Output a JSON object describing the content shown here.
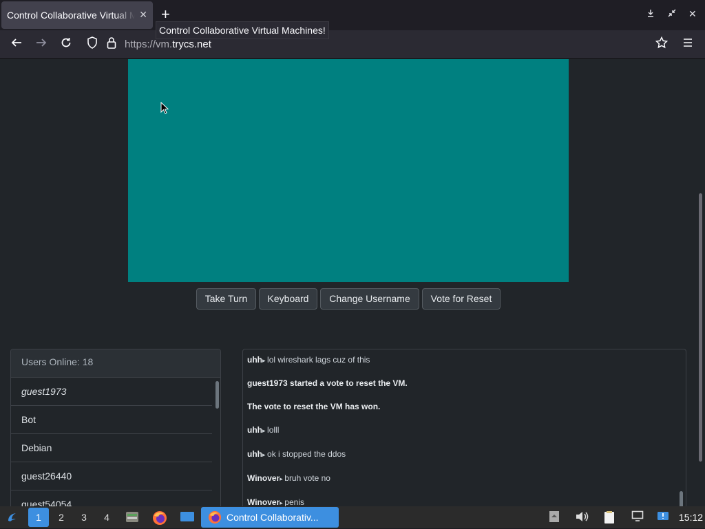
{
  "browser": {
    "tab_title": "Control Collaborative Virtual Machines!",
    "tab_close_icon": "close-icon",
    "new_tab_label": "+",
    "tooltip": "Control Collaborative Virtual Machines!",
    "url_prefix": "https://vm.",
    "url_domain": "trycs.net",
    "window_controls": [
      "minimize-icon",
      "restore-icon",
      "close-icon"
    ]
  },
  "vm": {
    "screen_color": "#008080"
  },
  "controls": {
    "take_turn": "Take Turn",
    "keyboard": "Keyboard",
    "change_username": "Change Username",
    "vote_reset": "Vote for Reset"
  },
  "users": {
    "header": "Users Online: 18",
    "list": [
      "guest1973",
      "Bot",
      "Debian",
      "guest26440",
      "guest54054"
    ]
  },
  "chat": {
    "messages": [
      {
        "user": "uhh",
        "text": "lol wireshark lags cuz of this"
      },
      {
        "system": "guest1973 started a vote to reset the VM."
      },
      {
        "system": "The vote to reset the VM has won."
      },
      {
        "user": "uhh",
        "text": "lolll"
      },
      {
        "user": "uhh",
        "text": "ok i stopped the ddos"
      },
      {
        "user": "Winover",
        "text": "bruh vote no"
      },
      {
        "user": "Winover",
        "text": "penis"
      }
    ]
  },
  "taskbar": {
    "workspaces": [
      "1",
      "2",
      "3",
      "4"
    ],
    "active_workspace": "1",
    "task_label": "Control Collaborativ...",
    "clock": "15:12",
    "accent": "#3d8fe0"
  }
}
